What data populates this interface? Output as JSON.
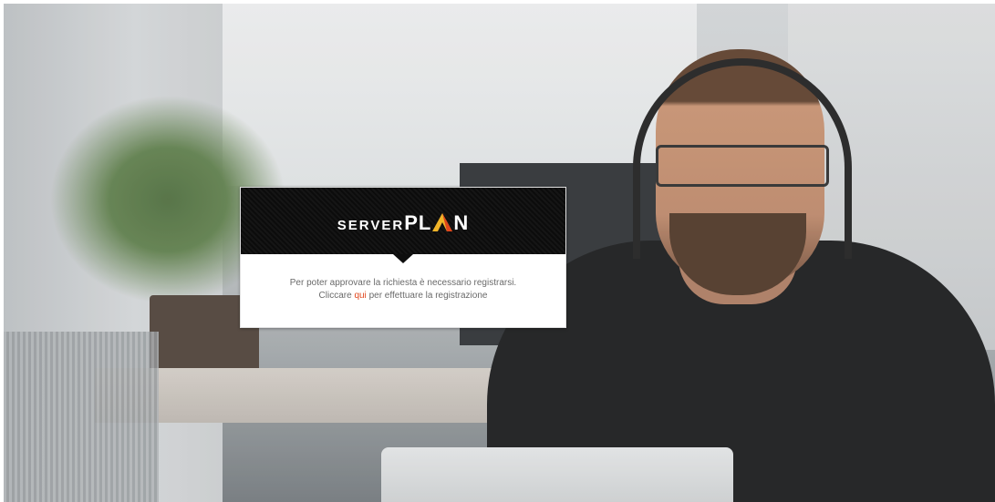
{
  "dialog": {
    "logo": {
      "part_small": "SERVER",
      "part_big_a": "PL",
      "part_big_b": "N"
    },
    "message": {
      "line1": "Per poter approvare la richiesta è necessario registrarsi.",
      "line2_before": "Cliccare ",
      "link_text": "qui",
      "line2_after": " per effettuare la registrazione"
    }
  },
  "colors": {
    "header_bg": "#0e0e0e",
    "link": "#e0461c",
    "logo_accent": "#f0b429",
    "text": "#6a6a6a"
  },
  "icons": {
    "logo_peak": "triangle-peak-icon"
  }
}
